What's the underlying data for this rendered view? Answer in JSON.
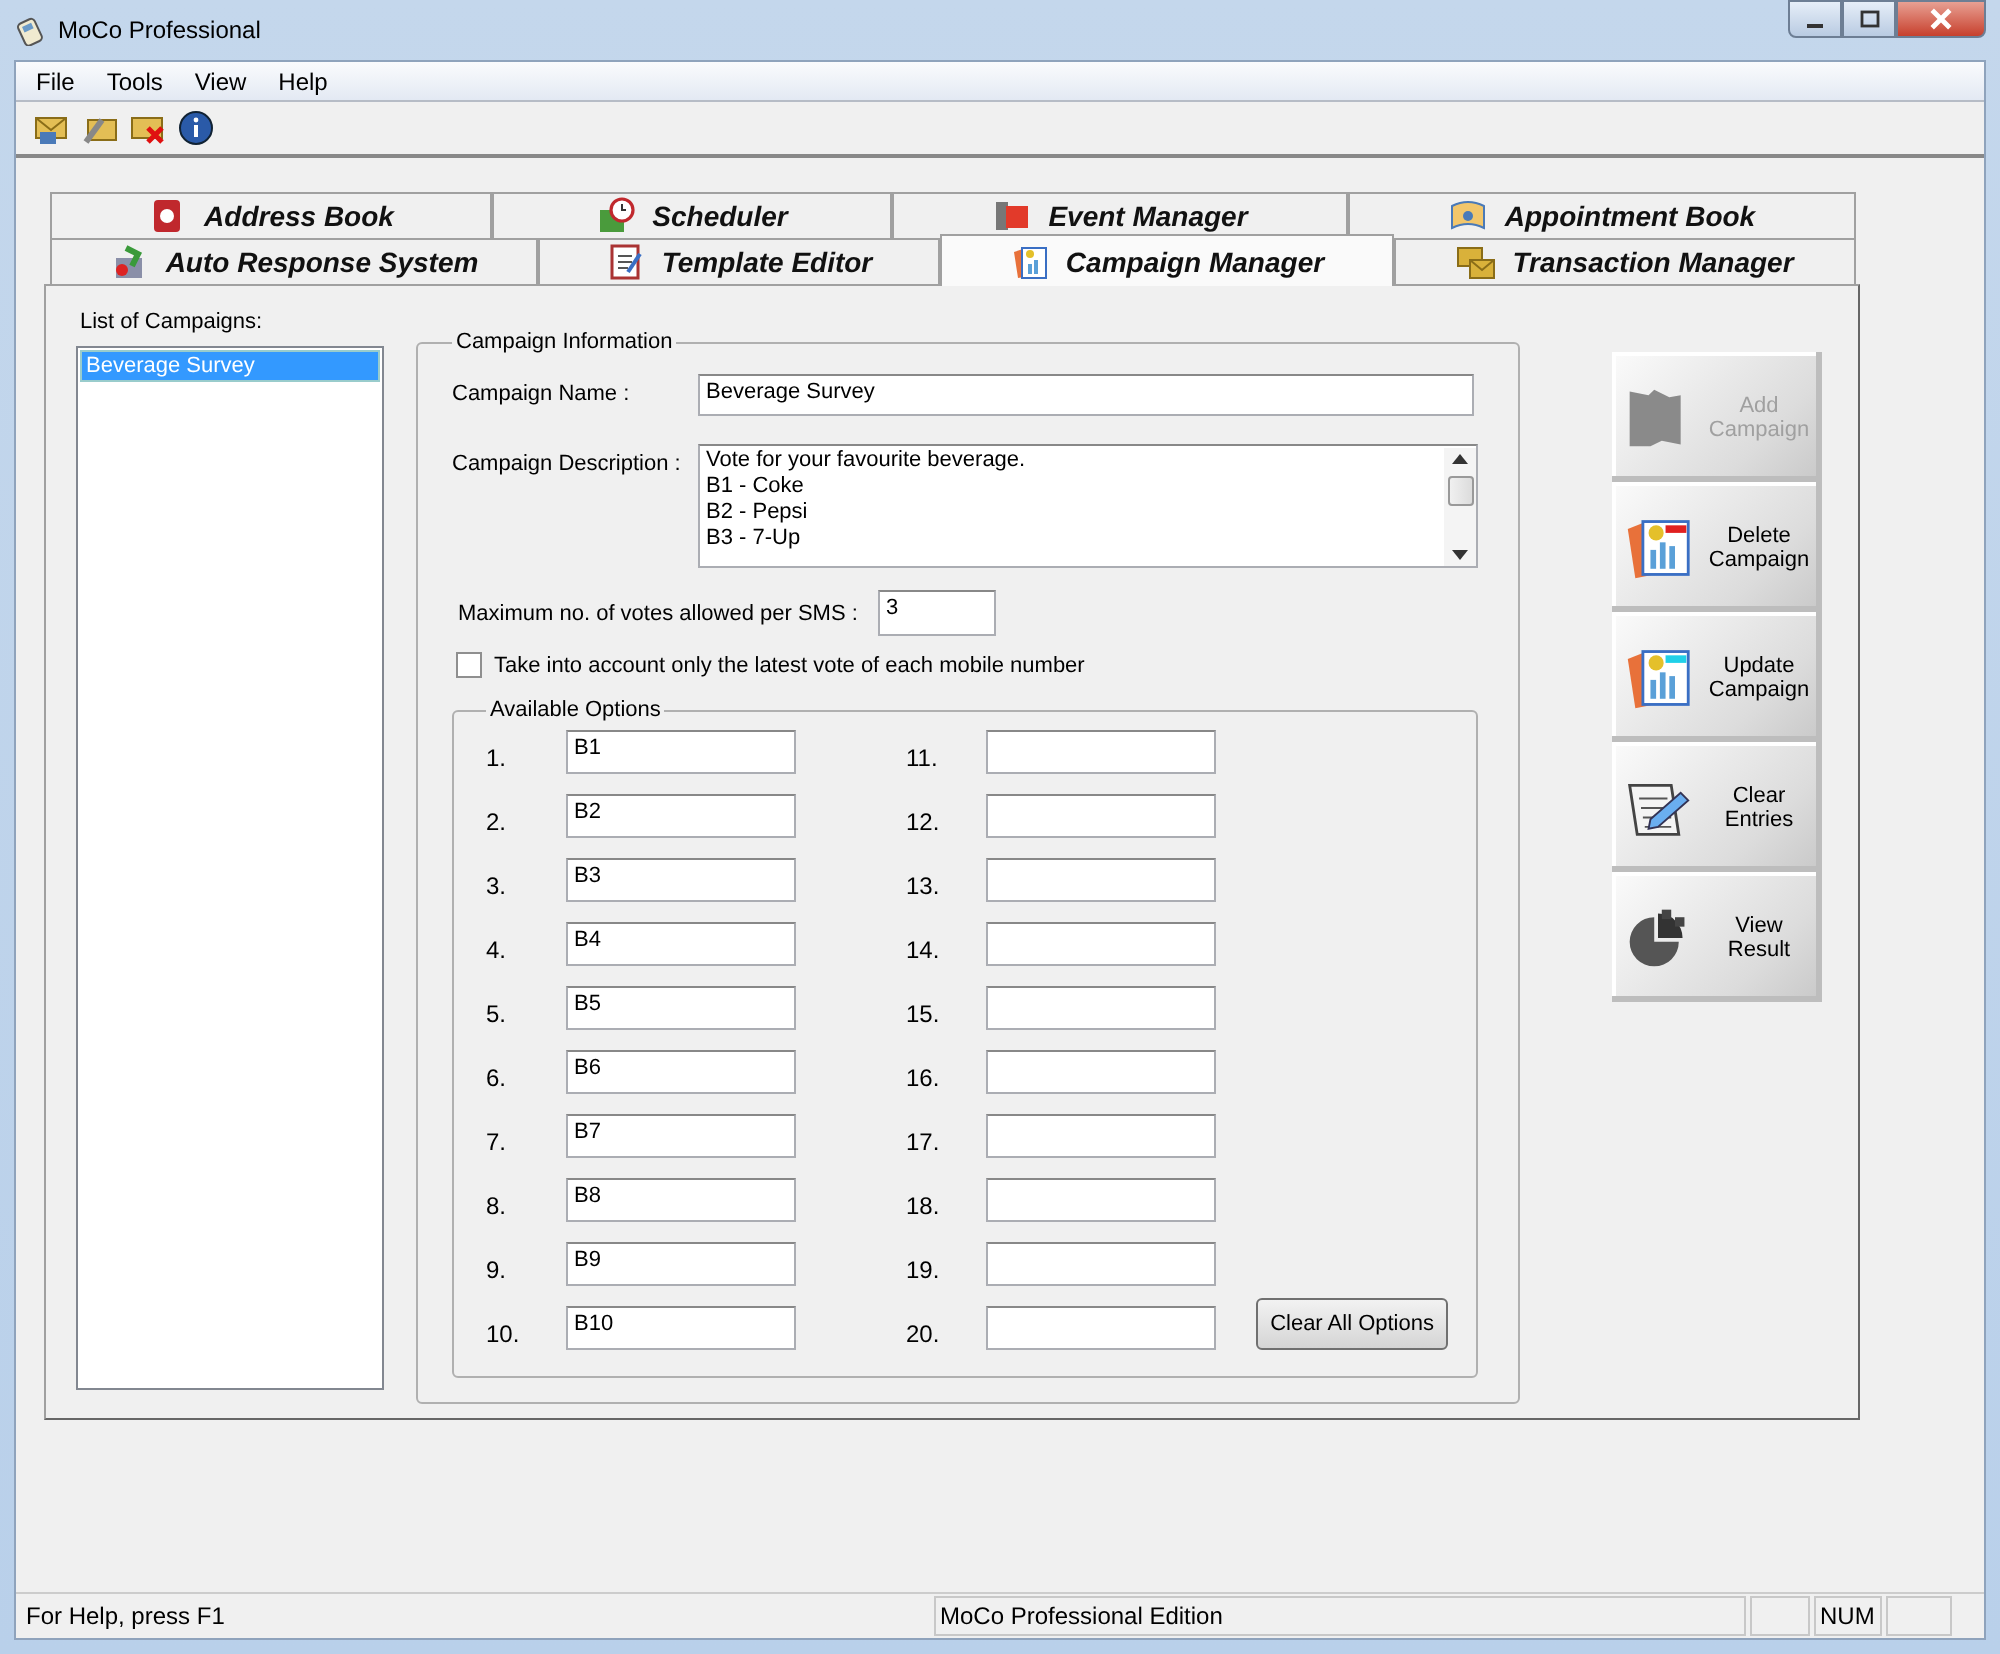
{
  "window": {
    "title": "MoCo Professional"
  },
  "menu": [
    "File",
    "Tools",
    "View",
    "Help"
  ],
  "tabs": {
    "back_row": [
      {
        "label": "Address Book",
        "selected": false
      },
      {
        "label": "Scheduler",
        "selected": false
      },
      {
        "label": "Event Manager",
        "selected": false
      },
      {
        "label": "Appointment Book",
        "selected": false
      }
    ],
    "front_row": [
      {
        "label": "Auto Response System",
        "selected": false
      },
      {
        "label": "Template Editor",
        "selected": false
      },
      {
        "label": "Campaign Manager",
        "selected": true
      },
      {
        "label": "Transaction Manager",
        "selected": false
      }
    ]
  },
  "campaign_list": {
    "label": "List of Campaigns:",
    "items": [
      {
        "label": "Beverage Survey",
        "selected": true
      }
    ]
  },
  "campaign_information": {
    "title": "Campaign Information",
    "name_label": "Campaign Name :",
    "name_value": "Beverage Survey",
    "description_label": "Campaign Description :",
    "description_lines": [
      "Vote for your favourite beverage.",
      "B1 - Coke",
      "B2 - Pepsi",
      "B3 - 7-Up"
    ],
    "max_votes_label": "Maximum no. of votes allowed per SMS :",
    "max_votes_value": "3",
    "latest_vote_checkbox": {
      "label": "Take into account only the latest vote of each mobile number",
      "checked": false
    },
    "available_options": {
      "title": "Available Options",
      "options": [
        {
          "number": "1.",
          "value": "B1"
        },
        {
          "number": "2.",
          "value": "B2"
        },
        {
          "number": "3.",
          "value": "B3"
        },
        {
          "number": "4.",
          "value": "B4"
        },
        {
          "number": "5.",
          "value": "B5"
        },
        {
          "number": "6.",
          "value": "B6"
        },
        {
          "number": "7.",
          "value": "B7"
        },
        {
          "number": "8.",
          "value": "B8"
        },
        {
          "number": "9.",
          "value": "B9"
        },
        {
          "number": "10.",
          "value": "B10"
        },
        {
          "number": "11."
        },
        {
          "number": "12."
        },
        {
          "number": "13."
        },
        {
          "number": "14."
        },
        {
          "number": "15."
        },
        {
          "number": "16."
        },
        {
          "number": "17."
        },
        {
          "number": "18."
        },
        {
          "number": "19."
        },
        {
          "number": "20."
        }
      ],
      "clear_button": "Clear All Options"
    }
  },
  "actions": [
    {
      "label": "Add Campaign",
      "disabled": true
    },
    {
      "label": "Delete Campaign",
      "disabled": false
    },
    {
      "label": "Update Campaign",
      "disabled": false
    },
    {
      "label": "Clear Entries",
      "disabled": false
    },
    {
      "label": "View Result",
      "disabled": false
    }
  ],
  "status_bar": {
    "help": "For Help, press F1",
    "edition": "MoCo Professional Edition",
    "num": "NUM"
  }
}
